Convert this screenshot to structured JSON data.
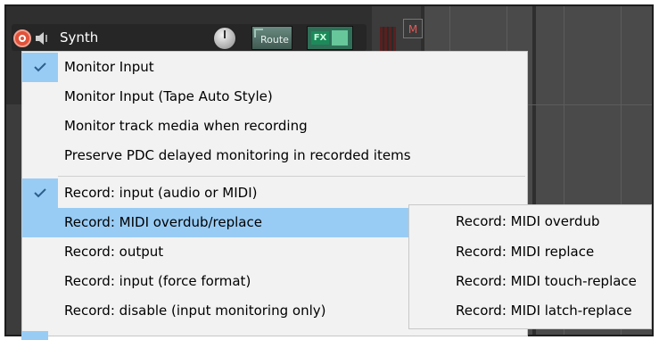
{
  "track": {
    "name": "Synth",
    "route_label": "Route",
    "fx_label": "FX",
    "mute_label": "M"
  },
  "menu": {
    "items": [
      {
        "label": "Monitor Input",
        "checked": true
      },
      {
        "label": "Monitor Input (Tape Auto Style)",
        "checked": false
      },
      {
        "label": "Monitor track media when recording",
        "checked": false
      },
      {
        "label": "Preserve PDC delayed monitoring in recorded items",
        "checked": false
      },
      {
        "label": "Record: input (audio or MIDI)",
        "checked": true
      },
      {
        "label": "Record: MIDI overdub/replace",
        "checked": false,
        "highlighted": true
      },
      {
        "label": "Record: output",
        "checked": false
      },
      {
        "label": "Record: input (force format)",
        "checked": false
      },
      {
        "label": "Record: disable (input monitoring only)",
        "checked": false
      }
    ]
  },
  "submenu": {
    "items": [
      "Record: MIDI overdub",
      "Record: MIDI replace",
      "Record: MIDI touch-replace",
      "Record: MIDI latch-replace"
    ]
  },
  "colors": {
    "highlight": "#99ccf5",
    "menu_bg": "#f2f2f2",
    "record_button": "#e0523a"
  }
}
